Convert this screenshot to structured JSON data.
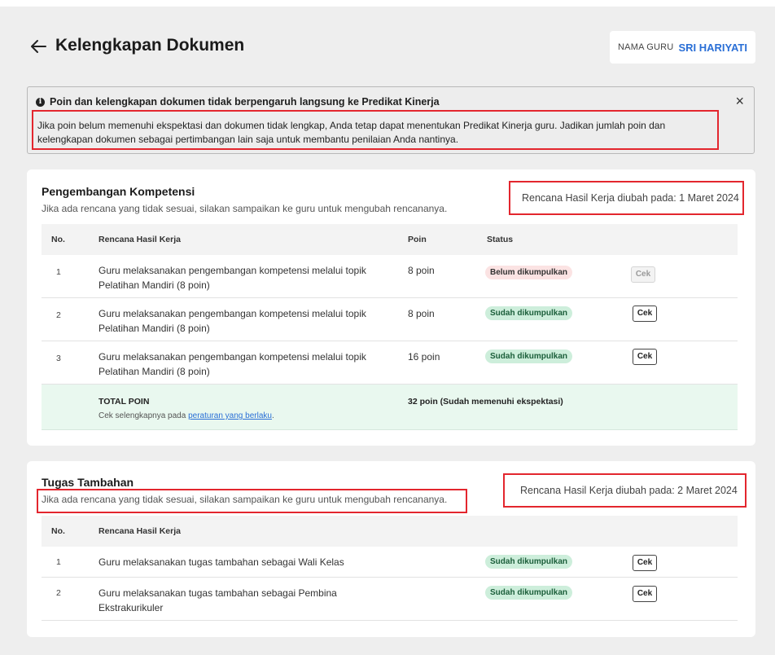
{
  "header": {
    "title": "Kelengkapan Dokumen",
    "guru_label": "NAMA GURU",
    "guru_name": "SRI HARIYATI"
  },
  "alert": {
    "title": "Poin dan kelengkapan dokumen tidak berpengaruh langsung ke Predikat Kinerja",
    "body": "Jika poin belum memenuhi ekspektasi dan dokumen tidak lengkap, Anda tetap dapat menentukan Predikat Kinerja guru. Jadikan jumlah poin dan kelengkapan dokumen sebagai pertimbangan lain saja untuk membantu penilaian Anda nantinya.",
    "close": "×"
  },
  "kompetensi": {
    "title": "Pengembangan Kompetensi",
    "subtitle": "Jika ada rencana yang tidak sesuai, silakan sampaikan ke guru untuk mengubah rencananya.",
    "meta": "Rencana Hasil Kerja diubah pada: 1 Maret 2024",
    "columns": {
      "no": "No.",
      "rencana": "Rencana Hasil Kerja",
      "poin": "Poin",
      "status": "Status"
    },
    "rows": [
      {
        "no": "1",
        "rencana": "Guru melaksanakan pengembangan kompetensi melalui topik Pelatihan Mandiri (8 poin)",
        "poin": "8 poin",
        "status": "Belum dikumpulkan",
        "button": "Cek"
      },
      {
        "no": "2",
        "rencana": "Guru melaksanakan pengembangan kompetensi melalui topik Pelatihan Mandiri (8 poin)",
        "poin": "8 poin",
        "status": "Sudah dikumpulkan",
        "button": "Cek"
      },
      {
        "no": "3",
        "rencana": "Guru melaksanakan pengembangan kompetensi melalui topik Pelatihan Mandiri (8 poin)",
        "poin": "16 poin",
        "status": "Sudah dikumpulkan",
        "button": "Cek"
      }
    ],
    "total": {
      "label": "TOTAL POIN",
      "note_prefix": "Cek selengkapnya pada",
      "note_link": "peraturan yang berlaku",
      "note_suffix": ".",
      "value": "32 poin (Sudah memenuhi ekspektasi)"
    }
  },
  "tambahan": {
    "title": "Tugas Tambahan",
    "subtitle": "Jika ada rencana yang tidak sesuai, silakan sampaikan ke guru untuk mengubah rencananya.",
    "meta": "Rencana Hasil Kerja diubah pada: 2 Maret 2024",
    "columns": {
      "no": "No.",
      "rencana": "Rencana Hasil Kerja"
    },
    "rows": [
      {
        "no": "1",
        "rencana": "Guru melaksanakan tugas tambahan sebagai Wali Kelas",
        "status": "Sudah dikumpulkan",
        "button": "Cek"
      },
      {
        "no": "2",
        "rencana": "Guru melaksanakan tugas tambahan sebagai Pembina Ekstrakurikuler",
        "status": "Sudah dikumpulkan",
        "button": "Cek"
      }
    ]
  },
  "colors": {
    "accent": "#2a6fd6",
    "highlight_box": "#e3262e",
    "badge_pending": "#fbe3e3",
    "badge_done": "#cdeedb"
  }
}
